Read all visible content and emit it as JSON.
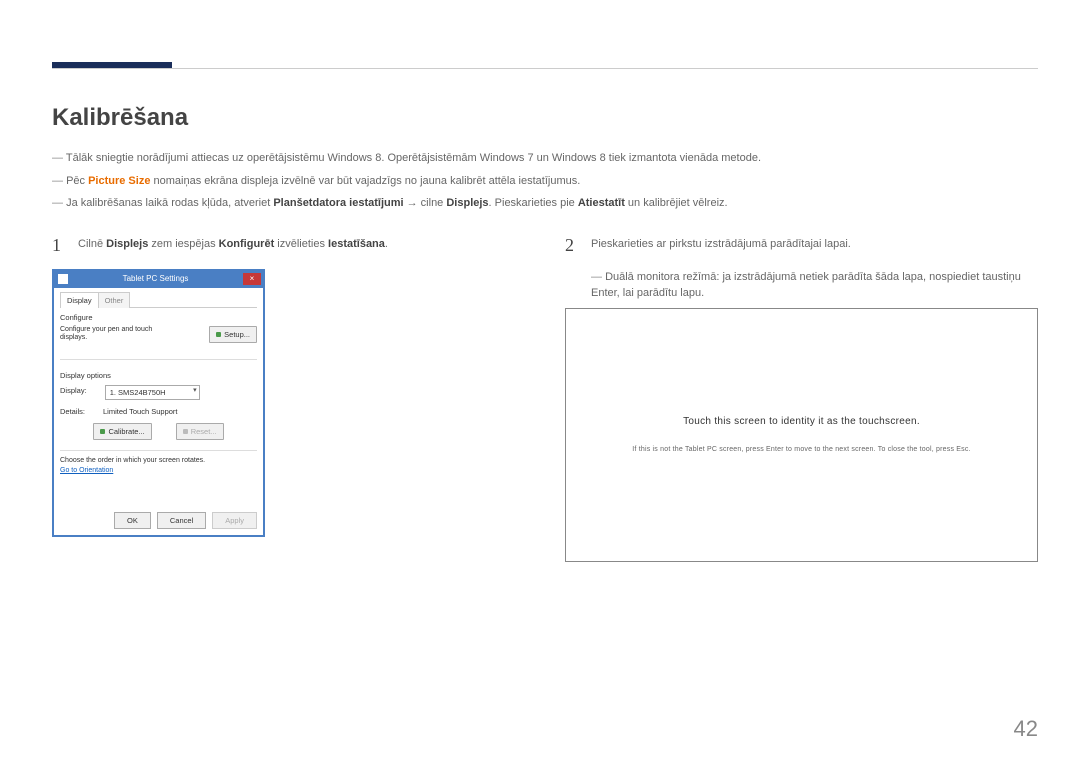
{
  "heading": "Kalibrēšana",
  "intro_1_pre": "Tālāk sniegtie norādījumi attiecas uz operētājsistēmu Windows 8. Operētājsistēmām Windows 7 un Windows 8 tiek izmantota vienāda metode.",
  "intro_2_pre": "Pēc ",
  "intro_2_bold": "Picture Size",
  "intro_2_post": " nomaiņas ekrāna displeja izvēlnē var būt vajadzīgs no jauna kalibrēt attēla iestatījumus.",
  "intro_3_pre": "Ja kalibrēšanas laikā rodas kļūda, atveriet ",
  "intro_3_b1": "Planšetdatora iestatījumi",
  "intro_3_mid": " → cilne ",
  "intro_3_b2": "Displejs",
  "intro_3_mid2": ". Pieskarieties pie ",
  "intro_3_b3": "Atiestatīt",
  "intro_3_post": " un kalibrējiet vēlreiz.",
  "step1_num": "1",
  "step1_pre": "Cilnē ",
  "step1_b1": "Displejs",
  "step1_mid": " zem iespējas ",
  "step1_b2": "Konfigurēt",
  "step1_mid2": " izvēlieties ",
  "step1_b3": "Iestatīšana",
  "step1_post": ".",
  "step2_num": "2",
  "step2_text": "Pieskarieties ar pirkstu izstrādājumā parādītajai lapai.",
  "step2_sub": "Duālā monitora režīmā: ja izstrādājumā netiek parādīta šāda lapa, nospiediet taustiņu Enter, lai parādītu lapu.",
  "dialog": {
    "title": "Tablet PC Settings",
    "tab_display": "Display",
    "tab_other": "Other",
    "configure": "Configure",
    "configure_text": "Configure your pen and touch displays.",
    "setup_btn": "Setup...",
    "display_options": "Display options",
    "display_label": "Display:",
    "display_value": "1. SMS24B750H",
    "details_label": "Details:",
    "details_value": "Limited Touch Support",
    "calibrate_btn": "Calibrate...",
    "reset_btn": "Reset...",
    "choose_text": "Choose the order in which your screen rotates.",
    "orientation_link": "Go to Orientation",
    "ok": "OK",
    "cancel": "Cancel",
    "apply": "Apply"
  },
  "touch": {
    "main": "Touch this screen to identity it as the touchscreen.",
    "sub": "If this is not the Tablet PC screen, press Enter to move to the next screen. To close the tool, press Esc."
  },
  "pagenum": "42"
}
